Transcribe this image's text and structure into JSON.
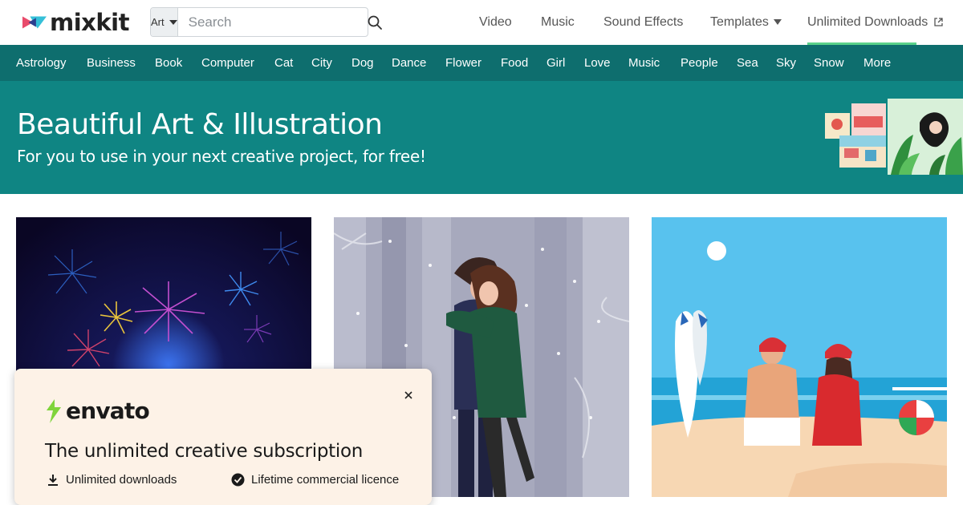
{
  "brand": {
    "name": "mixkit",
    "accent": "#0f8583",
    "nav_bar_color": "#0e6e6e"
  },
  "search": {
    "category": "Art",
    "placeholder": "Search",
    "value": ""
  },
  "topnav": {
    "video": "Video",
    "music": "Music",
    "sound_effects": "Sound Effects",
    "templates": "Templates",
    "unlimited": "Unlimited Downloads"
  },
  "categories": [
    "Astrology",
    "Business",
    "Book",
    "Computer",
    "Cat",
    "City",
    "Dog",
    "Dance",
    "Flower",
    "Food",
    "Girl",
    "Love",
    "Music",
    "People",
    "Sea",
    "Sky",
    "Snow",
    "More"
  ],
  "hero": {
    "title": "Beautiful Art & Illustration",
    "subtitle": "For you to use in your next creative project, for free!"
  },
  "cards": [
    {
      "subject": "fireworks"
    },
    {
      "subject": "couple-hugging-snow"
    },
    {
      "subject": "beach-santa-hats"
    }
  ],
  "popup": {
    "logo_text": "envato",
    "title": "The unlimited creative subscription",
    "features": [
      "Unlimited downloads",
      "Lifetime commercial licence"
    ]
  }
}
